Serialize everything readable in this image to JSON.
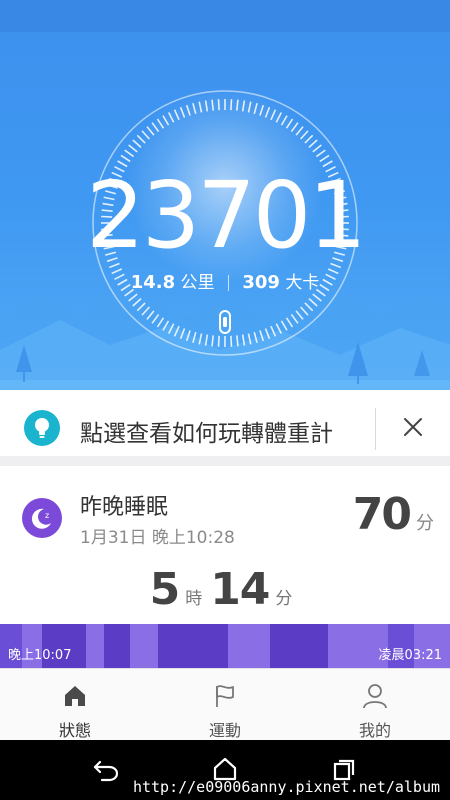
{
  "activity": {
    "steps": "23701",
    "distance_value": "14.8",
    "distance_unit": "公里",
    "calories_value": "309",
    "calories_unit": "大卡"
  },
  "tip": {
    "text": "點選查看如何玩轉體重計"
  },
  "sleep": {
    "title": "昨晚睡眠",
    "date": "1月31日 晚上10:28",
    "score": "70",
    "score_unit": "分",
    "hours": "5",
    "hours_unit": "時",
    "minutes": "14",
    "minutes_unit": "分",
    "start_time": "晚上10:07",
    "end_time": "凌晨03:21"
  },
  "bottom_nav": {
    "items": [
      {
        "label": "狀態",
        "icon": "home-icon"
      },
      {
        "label": "運動",
        "icon": "flag-icon"
      },
      {
        "label": "我的",
        "icon": "person-icon"
      }
    ]
  },
  "system_nav": {
    "icons": [
      "back-icon",
      "home-button-icon",
      "recents-icon"
    ]
  },
  "watermark": "http://e09006anny.pixnet.net/album",
  "colors": {
    "hero_blue": "#3f98f1",
    "tip_icon": "#1ab4cf",
    "sleep_purple": "#7c4ad8",
    "deep_sleep": "#5b3cc4",
    "light_sleep": "#8a6ee6"
  }
}
